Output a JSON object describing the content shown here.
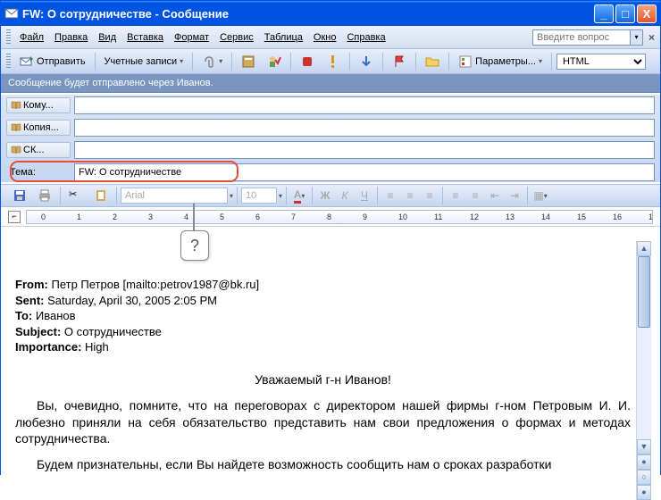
{
  "window": {
    "title": "FW: О сотрудничестве - Сообщение"
  },
  "menu": {
    "items": [
      "Файл",
      "Правка",
      "Вид",
      "Вставка",
      "Формат",
      "Сервис",
      "Таблица",
      "Окно",
      "Справка"
    ],
    "help_placeholder": "Введите вопрос"
  },
  "toolbar": {
    "send": "Отправить",
    "accounts": "Учетные записи",
    "options": "Параметры...",
    "format_select": "HTML"
  },
  "info_bar": "Сообщение будет отправлено через Иванов.",
  "fields": {
    "to_label": "Кому...",
    "cc_label": "Копия...",
    "bcc_label": "СК...",
    "subject_label": "Тема:",
    "to_value": "",
    "cc_value": "",
    "bcc_value": "",
    "subject_value": "FW: О сотрудничестве"
  },
  "format_bar": {
    "font": "Arial",
    "size": "10"
  },
  "body": {
    "from_label": "From:",
    "from_value": "Петр Петров [mailto:petrov1987@bk.ru]",
    "sent_label": "Sent:",
    "sent_value": "Saturday, April 30, 2005 2:05 PM",
    "to_label": "To:",
    "to_value": "Иванов",
    "subject_label": "Subject:",
    "subject_value": "О сотрудничестве",
    "importance_label": "Importance:",
    "importance_value": "High",
    "greeting": "Уважаемый г-н Иванов!",
    "para1": "Вы, очевидно, помните, что на переговорах с директором нашей фирмы г-ном Петровым И. И. любезно приняли на себя обязательство представить нам свои предложения о формах и методах сотрудничества.",
    "para2": "Будем признательны, если Вы найдете возможность сообщить нам о сроках разработки"
  },
  "callout": {
    "text": "?"
  }
}
